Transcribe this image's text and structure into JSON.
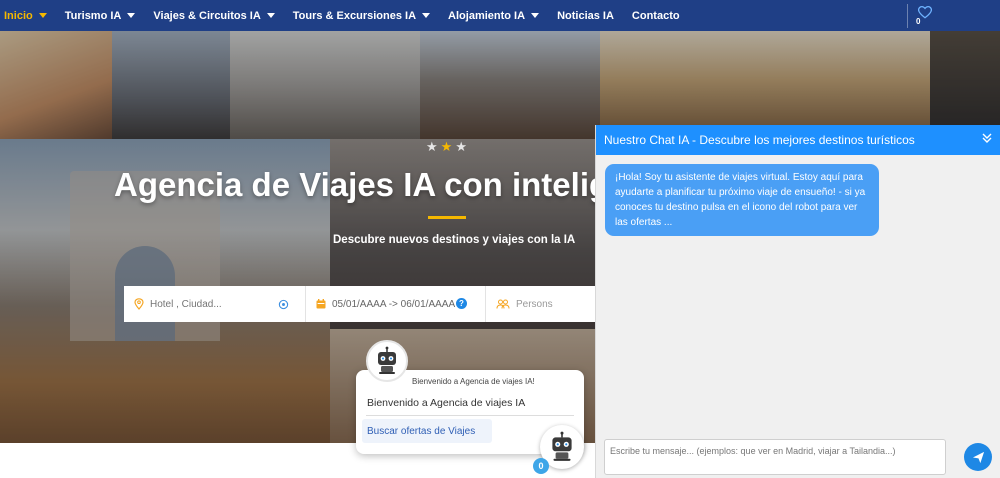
{
  "nav": {
    "items": [
      {
        "label": "Inicio",
        "dropdown": true,
        "active": true
      },
      {
        "label": "Turismo IA",
        "dropdown": true
      },
      {
        "label": "Viajes & Circuitos IA",
        "dropdown": true
      },
      {
        "label": "Tours & Excursiones IA",
        "dropdown": true
      },
      {
        "label": "Alojamiento IA",
        "dropdown": true
      },
      {
        "label": "Noticias IA",
        "dropdown": false
      },
      {
        "label": "Contacto",
        "dropdown": false
      }
    ],
    "favorites_count": "0",
    "favorites_icon": "heart-icon",
    "bg_color": "#1f3f86",
    "active_color": "#f5b800"
  },
  "hero": {
    "star_icons": [
      "star-gray",
      "star-gold",
      "star-gray"
    ],
    "title": "Agencia de Viajes IA con inteligencia",
    "subtitle": "Descubre nuevos destinos y viajes con la IA"
  },
  "search": {
    "location_placeholder": "Hotel , Ciudad...",
    "dates": "05/01/AAAA -> 06/01/AAAA",
    "persons": "Persons",
    "location_icon": "map-pin-icon",
    "target_icon": "crosshair-icon",
    "calendar_icon": "calendar-icon",
    "help_icon": "question-icon",
    "help_label": "?",
    "persons_icon": "users-icon"
  },
  "welcome": {
    "small_text": "Bienvenido a Agencia de viajes IA!",
    "main_text": "Bienvenido a Agencia de viajes IA",
    "button_label": "Buscar ofertas de Viajes",
    "badge_count": "0"
  },
  "chat": {
    "title": "Nuestro Chat IA - Descubre los mejores destinos turísticos",
    "message": "¡Hola! Soy tu asistente de viajes virtual. Estoy aquí para ayudarte a planificar tu próximo viaje de ensueño! - si ya conoces tu destino pulsa en el icono del robot para ver las ofertas ...",
    "input_placeholder": "Escribe tu mensaje... (ejemplos: que ver en Madrid, viajar a Tailandia...)",
    "header_color": "#1e90ff",
    "bubble_color": "#4a9ff5"
  }
}
